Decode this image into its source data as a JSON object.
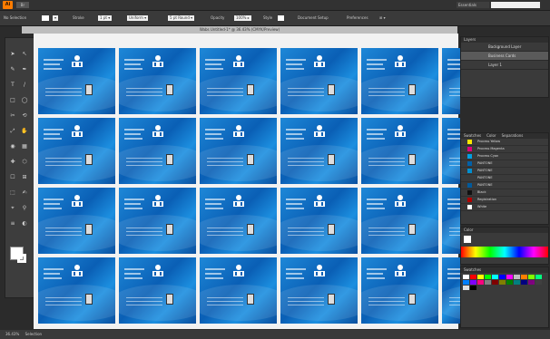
{
  "app": {
    "logo": "Ai",
    "bridge": "Br",
    "workspace": "Essentials",
    "search_placeholder": ""
  },
  "control_bar": {
    "label": "No Selection",
    "stroke": "Stroke",
    "opacity": "Opacity",
    "style": "Style",
    "doc_setup": "Document Setup",
    "preferences": "Preferences"
  },
  "document": {
    "tab_title": "Wabs Untitled-1* @ 36.43% (CMYK/Preview)"
  },
  "tools": [
    "➤",
    "↖",
    "✎",
    "✒",
    "T",
    "/",
    "□",
    "◯",
    "✂",
    "⟲",
    "⤢",
    "✋",
    "◉",
    "▦",
    "✚",
    "⬡",
    "☐",
    "⊞",
    "⬚",
    "✍",
    "⌖",
    "⚲",
    "≡",
    "◐"
  ],
  "layers_panel": {
    "title": "Layers",
    "rows": [
      "Background Layer",
      "Business Cards",
      "Layer 1"
    ]
  },
  "swatch_panel": {
    "tabs": [
      "Swatches",
      "Color",
      "Separations"
    ],
    "rows": [
      {
        "name": "Process Yellow",
        "color": "#ffe600"
      },
      {
        "name": "Process Magenta",
        "color": "#e0007a"
      },
      {
        "name": "Process Cyan",
        "color": "#00a0e3"
      },
      {
        "name": "PANTONE",
        "color": "#0060a8"
      },
      {
        "name": "PANTONE",
        "color": "#008fd0"
      },
      {
        "name": "PANTONE",
        "color": "#3a3a3a"
      },
      {
        "name": "PANTONE",
        "color": "#005a9c"
      },
      {
        "name": "Black",
        "color": "#111111"
      },
      {
        "name": "Registration",
        "color": "#b00000"
      },
      {
        "name": "White",
        "color": "#ffffff"
      }
    ]
  },
  "color_panel": {
    "title": "Color"
  },
  "swatches_grid": {
    "title": "Swatches",
    "colors": [
      "#ffffff",
      "#ff0000",
      "#ffff00",
      "#00ff00",
      "#00ffff",
      "#0000ff",
      "#ff00ff",
      "#c0c0c0",
      "#ff7f00",
      "#7fff00",
      "#00ff7f",
      "#007fff",
      "#7f00ff",
      "#ff007f",
      "#808080",
      "#800000",
      "#808000",
      "#008000",
      "#008080",
      "#000080",
      "#800080",
      "#404040",
      "#e0e0e0",
      "#000000"
    ]
  },
  "status_bar": {
    "zoom": "36.43%",
    "mode": "Selection"
  }
}
